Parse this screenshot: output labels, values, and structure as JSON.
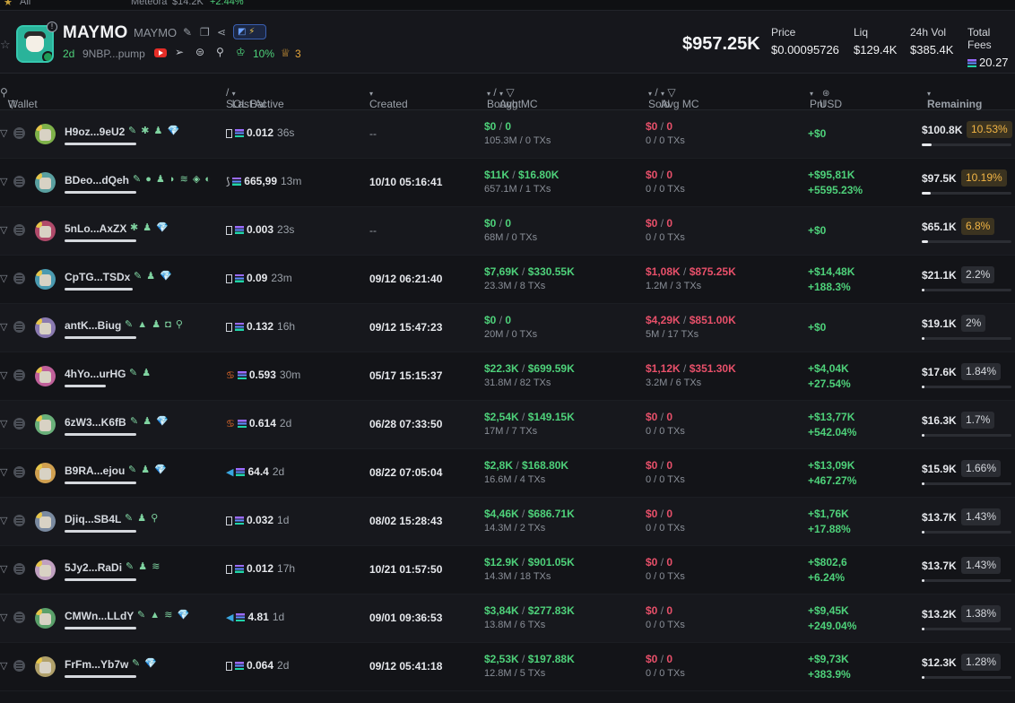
{
  "topstrip": {
    "all_label": "All",
    "pair": "Meteora",
    "price": "$14.2K",
    "change": "+2.44%"
  },
  "token": {
    "name": "MAYMO",
    "symbol": "MAYMO",
    "age": "2d",
    "address": "9NBP...pump",
    "top10_pct": "10%",
    "dev_holdings": "3",
    "market_cap": "$957.25K"
  },
  "stats": {
    "price_label": "Price",
    "price_value": "$0.00095726",
    "liq_label": "Liq",
    "liq_value": "$129.4K",
    "vol_label": "24h Vol",
    "vol_value": "$385.4K",
    "fees_label": "Total Fees",
    "fees_value": "20.27"
  },
  "columns": {
    "wallet": "Wallet",
    "sol_bal": "SOL Bal",
    "last_active": "Last Active",
    "created": "Created",
    "bought": "Bought",
    "avg_mc_bought": "Avg MC",
    "sold": "Sold",
    "avg_mc_sold": "Avg MC",
    "pnl": "Pnl",
    "usd": "USD",
    "remaining": "Remaining"
  },
  "rows": [
    {
      "wallet": "H9oz...9eU2",
      "icons": "✎ ✱ ♟ 💎",
      "avatar_color": "#7fb24a",
      "bar": 80,
      "sol_prefix": "box",
      "sol": "0.012",
      "active": "36s",
      "created": "--",
      "bought": "$0",
      "bought_mc": "0",
      "bought_sub": "105.3M / 0 TXs",
      "sold": "$0",
      "sold_mc": "0",
      "sold_sub": "0 / 0 TXs",
      "pnl1": "+$0",
      "pnl2": "",
      "remaining": "$100.8K",
      "rem_pct": "10.53%",
      "rem_frac": 0.105,
      "hi": true
    },
    {
      "wallet": "BDeo...dQeh",
      "icons": "✎ ● ♟ ◗ ≋ ◈ ◐",
      "avatar_color": "#5aa0a0",
      "bar": 80,
      "sol_prefix": "shrimp",
      "sol": "665,99",
      "active": "13m",
      "created": "10/10 05:16:41",
      "bought": "$11K",
      "bought_mc": "$16.80K",
      "bought_sub": "657.1M / 1 TXs",
      "sold": "$0",
      "sold_mc": "0",
      "sold_sub": "0 / 0 TXs",
      "pnl1": "+$95,81K",
      "pnl2": "+5595.23%",
      "remaining": "$97.5K",
      "rem_pct": "10.19%",
      "rem_frac": 0.102,
      "hi": true
    },
    {
      "wallet": "5nLo...AxZX",
      "icons": "✱ ♟ 💎",
      "avatar_color": "#b04a6a",
      "bar": 80,
      "sol_prefix": "box",
      "sol": "0.003",
      "active": "23s",
      "created": "--",
      "bought": "$0",
      "bought_mc": "0",
      "bought_sub": "68M / 0 TXs",
      "sold": "$0",
      "sold_mc": "0",
      "sold_sub": "0 / 0 TXs",
      "pnl1": "+$0",
      "pnl2": "",
      "remaining": "$65.1K",
      "rem_pct": "6.8%",
      "rem_frac": 0.068,
      "hi": true
    },
    {
      "wallet": "CpTG...TSDx",
      "icons": "✎ ♟ 💎",
      "avatar_color": "#4a9ab0",
      "bar": 76,
      "sol_prefix": "box",
      "sol": "0.09",
      "active": "23m",
      "created": "09/12 06:21:40",
      "bought": "$7,69K",
      "bought_mc": "$330.55K",
      "bought_sub": "23.3M / 8 TXs",
      "sold": "$1,08K",
      "sold_mc": "$875.25K",
      "sold_sub": "1.2M / 3 TXs",
      "pnl1": "+$14,48K",
      "pnl2": "+188.3%",
      "remaining": "$21.1K",
      "rem_pct": "2.2%",
      "rem_frac": 0.022,
      "hi": false
    },
    {
      "wallet": "antK...Biug",
      "icons": "✎ ▲ ♟ ◘ ⚲",
      "avatar_color": "#8a7ab0",
      "bar": 80,
      "sol_prefix": "box",
      "sol": "0.132",
      "active": "16h",
      "created": "09/12 15:47:23",
      "bought": "$0",
      "bought_mc": "0",
      "bought_sub": "20M / 0 TXs",
      "sold": "$4,29K",
      "sold_mc": "$851.00K",
      "sold_sub": "5M / 17 TXs",
      "pnl1": "+$0",
      "pnl2": "",
      "remaining": "$19.1K",
      "rem_pct": "2%",
      "rem_frac": 0.02,
      "hi": false
    },
    {
      "wallet": "4hYo...urHG",
      "icons": "✎ ♟",
      "avatar_color": "#c0609a",
      "bar": 46,
      "sol_prefix": "crab",
      "sol": "0.593",
      "active": "30m",
      "created": "05/17 15:15:37",
      "bought": "$22.3K",
      "bought_mc": "$699.59K",
      "bought_sub": "31.8M / 82 TXs",
      "sold": "$1,12K",
      "sold_mc": "$351.30K",
      "sold_sub": "3.2M / 6 TXs",
      "pnl1": "+$4,04K",
      "pnl2": "+27.54%",
      "remaining": "$17.6K",
      "rem_pct": "1.84%",
      "rem_frac": 0.018,
      "hi": false
    },
    {
      "wallet": "6zW3...K6fB",
      "icons": "✎ ♟ 💎",
      "avatar_color": "#6ab07a",
      "bar": 80,
      "sol_prefix": "crab",
      "sol": "0.614",
      "active": "2d",
      "created": "06/28 07:33:50",
      "bought": "$2,54K",
      "bought_mc": "$149.15K",
      "bought_sub": "17M / 7 TXs",
      "sold": "$0",
      "sold_mc": "0",
      "sold_sub": "0 / 0 TXs",
      "pnl1": "+$13,77K",
      "pnl2": "+542.04%",
      "remaining": "$16.3K",
      "rem_pct": "1.7%",
      "rem_frac": 0.017,
      "hi": false
    },
    {
      "wallet": "B9RA...ejou",
      "icons": "✎ ♟ 💎",
      "avatar_color": "#d0a050",
      "bar": 80,
      "sol_prefix": "fish",
      "sol": "64.4",
      "active": "2d",
      "created": "08/22 07:05:04",
      "bought": "$2,8K",
      "bought_mc": "$168.80K",
      "bought_sub": "16.6M / 4 TXs",
      "sold": "$0",
      "sold_mc": "0",
      "sold_sub": "0 / 0 TXs",
      "pnl1": "+$13,09K",
      "pnl2": "+467.27%",
      "remaining": "$15.9K",
      "rem_pct": "1.66%",
      "rem_frac": 0.017,
      "hi": false
    },
    {
      "wallet": "Djiq...SB4L",
      "icons": "✎ ♟ ⚲",
      "avatar_color": "#7a8aa0",
      "bar": 80,
      "sol_prefix": "box",
      "sol": "0.032",
      "active": "1d",
      "created": "08/02 15:28:43",
      "bought": "$4,46K",
      "bought_mc": "$686.71K",
      "bought_sub": "14.3M / 2 TXs",
      "sold": "$0",
      "sold_mc": "0",
      "sold_sub": "0 / 0 TXs",
      "pnl1": "+$1,76K",
      "pnl2": "+17.88%",
      "remaining": "$13.7K",
      "rem_pct": "1.43%",
      "rem_frac": 0.014,
      "hi": false
    },
    {
      "wallet": "5Jy2...RaDi",
      "icons": "✎ ♟ ≋",
      "avatar_color": "#c0a0c0",
      "bar": 80,
      "sol_prefix": "box",
      "sol": "0.012",
      "active": "17h",
      "created": "10/21 01:57:50",
      "bought": "$12.9K",
      "bought_mc": "$901.05K",
      "bought_sub": "14.3M / 18 TXs",
      "sold": "$0",
      "sold_mc": "0",
      "sold_sub": "0 / 0 TXs",
      "pnl1": "+$802,6",
      "pnl2": "+6.24%",
      "remaining": "$13.7K",
      "rem_pct": "1.43%",
      "rem_frac": 0.014,
      "hi": false
    },
    {
      "wallet": "CMWn...LLdY",
      "icons": "✎ ▲ ≋ 💎",
      "avatar_color": "#5aa06a",
      "bar": 80,
      "sol_prefix": "fish",
      "sol": "4.81",
      "active": "1d",
      "created": "09/01 09:36:53",
      "bought": "$3,84K",
      "bought_mc": "$277.83K",
      "bought_sub": "13.8M / 6 TXs",
      "sold": "$0",
      "sold_mc": "0",
      "sold_sub": "0 / 0 TXs",
      "pnl1": "+$9,45K",
      "pnl2": "+249.04%",
      "remaining": "$13.2K",
      "rem_pct": "1.38%",
      "rem_frac": 0.014,
      "hi": false
    },
    {
      "wallet": "FrFm...Yb7w",
      "icons": "✎ 💎",
      "avatar_color": "#b0a06a",
      "bar": 80,
      "sol_prefix": "box",
      "sol": "0.064",
      "active": "2d",
      "created": "09/12 05:41:18",
      "bought": "$2,53K",
      "bought_mc": "$197.88K",
      "bought_sub": "12.8M / 5 TXs",
      "sold": "$0",
      "sold_mc": "0",
      "sold_sub": "0 / 0 TXs",
      "pnl1": "+$9,73K",
      "pnl2": "+383.9%",
      "remaining": "$12.3K",
      "rem_pct": "1.28%",
      "rem_frac": 0.013,
      "hi": false
    }
  ]
}
